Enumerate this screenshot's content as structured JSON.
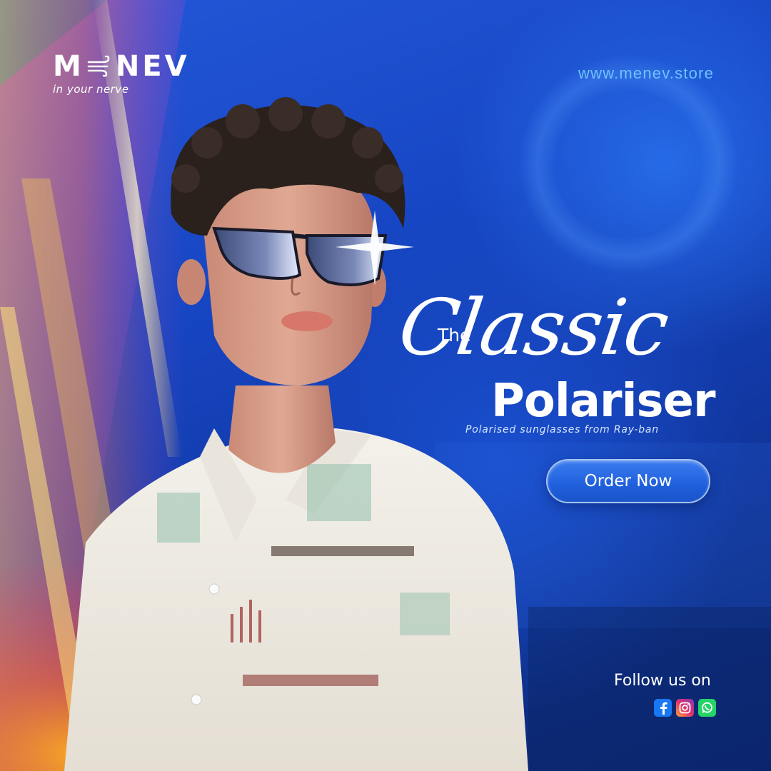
{
  "brand": {
    "logo_text": "MENEV",
    "logo_left": "M",
    "logo_right": "NEV",
    "tagline": "in your nerve"
  },
  "website": "www.menev.store",
  "headline": {
    "the": "The",
    "classic": "Classic",
    "polariser": "Polariser"
  },
  "subtitle": "Polarised sunglasses from Ray-ban",
  "cta": {
    "label": "Order Now"
  },
  "social": {
    "follow_label": "Follow us on",
    "icons": [
      "facebook-icon",
      "instagram-icon",
      "whatsapp-icon"
    ]
  },
  "colors": {
    "background": "#1746c4",
    "url_text": "#6ec3ff",
    "button": "#2563e0",
    "text": "#ffffff"
  }
}
